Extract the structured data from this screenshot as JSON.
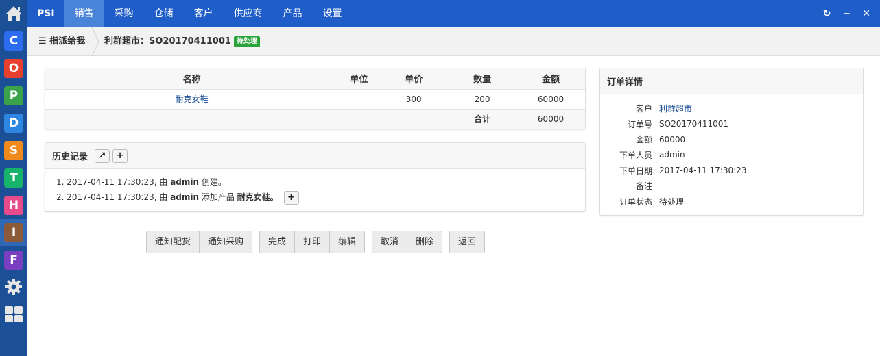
{
  "app": {
    "brand": "PSI",
    "nav": [
      "销售",
      "采购",
      "仓储",
      "客户",
      "供应商",
      "产品",
      "设置"
    ],
    "active_nav": "销售",
    "window_controls": [
      "refresh-icon",
      "minimize-icon",
      "close-icon"
    ]
  },
  "sidebar": {
    "items": [
      {
        "letter": "C",
        "color": "#2b6cf0"
      },
      {
        "letter": "O",
        "color": "#e8402f"
      },
      {
        "letter": "P",
        "color": "#3aa34a"
      },
      {
        "letter": "D",
        "color": "#2d86e0"
      },
      {
        "letter": "S",
        "color": "#f08a1c"
      },
      {
        "letter": "T",
        "color": "#17b36b"
      },
      {
        "letter": "H",
        "color": "#e84b8a"
      },
      {
        "letter": "I",
        "color": "#8b5a3a"
      },
      {
        "letter": "F",
        "color": "#7a3fc0"
      }
    ]
  },
  "breadcrumb": {
    "assigned": "指派给我",
    "current": "利群超市：SO20170411001",
    "status": "待处理"
  },
  "items_table": {
    "headers": [
      "名称",
      "单位",
      "单价",
      "数量",
      "金额"
    ],
    "rows": [
      {
        "name": "耐克女鞋",
        "unit": "",
        "price": "300",
        "qty": "200",
        "amount": "60000"
      }
    ],
    "total_label": "合计",
    "total_amount": "60000"
  },
  "history": {
    "title": "历史记录",
    "entries": [
      {
        "prefix": "1. 2017-04-11 17:30:23, 由 ",
        "user": "admin",
        "action": " 创建。",
        "product": ""
      },
      {
        "prefix": "2. 2017-04-11 17:30:23, 由 ",
        "user": "admin",
        "action": " 添加产品 ",
        "product": "耐克女鞋。"
      }
    ]
  },
  "details": {
    "title": "订单详情",
    "fields": [
      {
        "label": "客户",
        "value": "利群超市",
        "link": true
      },
      {
        "label": "订单号",
        "value": "SO20170411001",
        "link": false
      },
      {
        "label": "金额",
        "value": "60000",
        "link": false
      },
      {
        "label": "下单人员",
        "value": "admin",
        "link": false
      },
      {
        "label": "下单日期",
        "value": "2017-04-11 17:30:23",
        "link": false
      },
      {
        "label": "备注",
        "value": "",
        "link": false
      },
      {
        "label": "订单状态",
        "value": "待处理",
        "link": false
      }
    ]
  },
  "actions": {
    "notify_group": [
      "通知配货",
      "通知采购"
    ],
    "process_group": [
      "完成",
      "打印",
      "编辑"
    ],
    "cancel_group": [
      "取消",
      "删除"
    ],
    "back": "返回"
  }
}
